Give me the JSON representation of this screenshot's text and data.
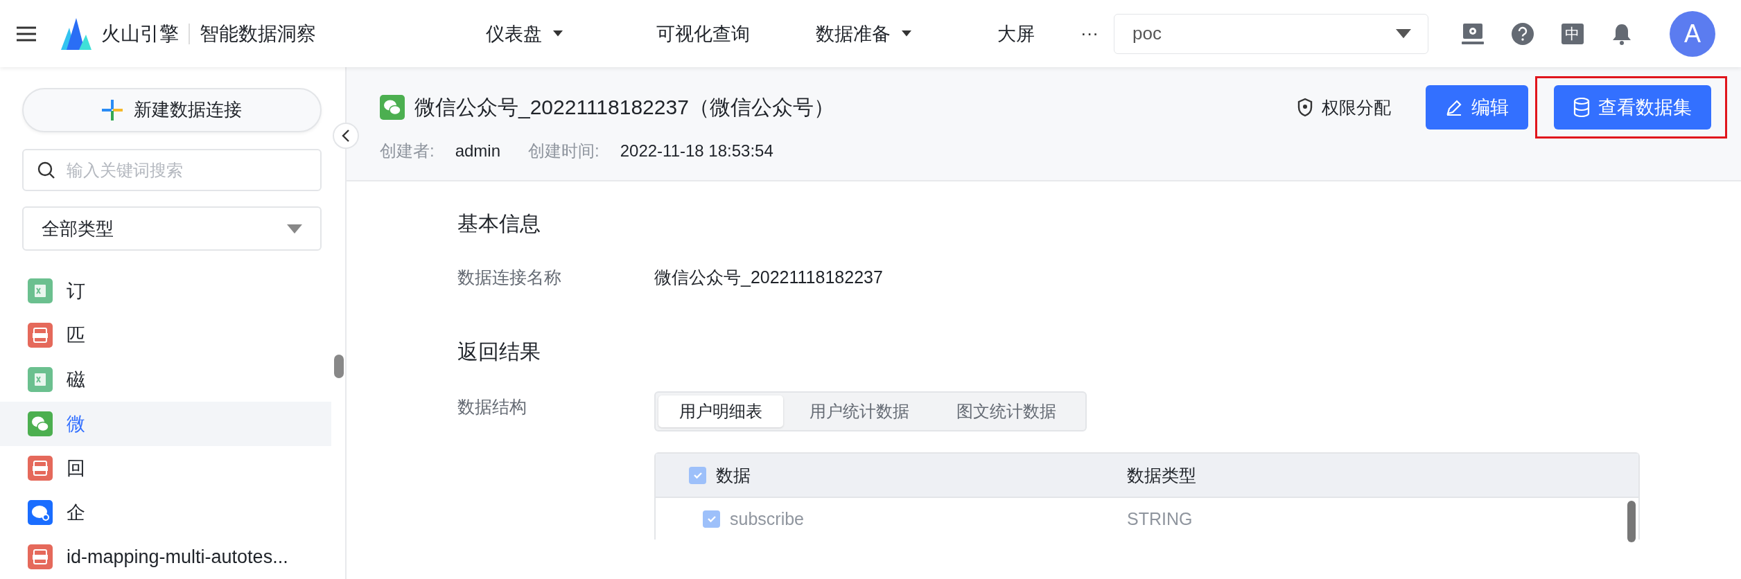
{
  "header": {
    "brand": "火山引擎",
    "product": "智能数据洞察",
    "nav": [
      {
        "label": "仪表盘",
        "dropdown": true
      },
      {
        "label": "可视化查询",
        "dropdown": false
      },
      {
        "label": "数据准备",
        "dropdown": true
      },
      {
        "label": "大屏",
        "dropdown": false
      }
    ],
    "more": "···",
    "project_select": {
      "value": "poc"
    },
    "language": "中",
    "avatar": "A"
  },
  "sidebar": {
    "new_button": "新建数据连接",
    "search": {
      "placeholder": "输入关键词搜索"
    },
    "type_select": {
      "value": "全部类型"
    },
    "items": [
      {
        "label": "订",
        "kind": "excel",
        "selected": false
      },
      {
        "label": "匹",
        "kind": "csv",
        "selected": false
      },
      {
        "label": "磁",
        "kind": "excel",
        "selected": false
      },
      {
        "label": "微",
        "kind": "wechat",
        "selected": true
      },
      {
        "label": "回",
        "kind": "csv",
        "selected": false
      },
      {
        "label": "企",
        "kind": "wecom",
        "selected": false
      },
      {
        "label": "id-mapping-multi-autotes...",
        "kind": "csv",
        "selected": false
      }
    ]
  },
  "detail": {
    "title": "微信公众号_20221118182237（微信公众号）",
    "permission": "权限分配",
    "edit": "编辑",
    "view_dataset": "查看数据集",
    "view_highlighted": true,
    "meta": [
      {
        "label": "创建者:",
        "value": "admin"
      },
      {
        "label": "创建时间:",
        "value": "2022-11-18 18:53:54"
      }
    ],
    "basic": {
      "heading": "基本信息",
      "fields": [
        {
          "label": "数据连接名称",
          "value": "微信公众号_20221118182237"
        }
      ]
    },
    "result": {
      "heading": "返回结果",
      "label": "数据结构",
      "tabs": [
        {
          "label": "用户明细表",
          "selected": true
        },
        {
          "label": "用户统计数据",
          "selected": false
        },
        {
          "label": "图文统计数据",
          "selected": false
        }
      ],
      "table": {
        "columns": [
          "数据",
          "数据类型"
        ],
        "all_checked": true,
        "rows": [
          {
            "name": "subscribe",
            "type": "STRING",
            "checked": true
          }
        ]
      }
    }
  }
}
